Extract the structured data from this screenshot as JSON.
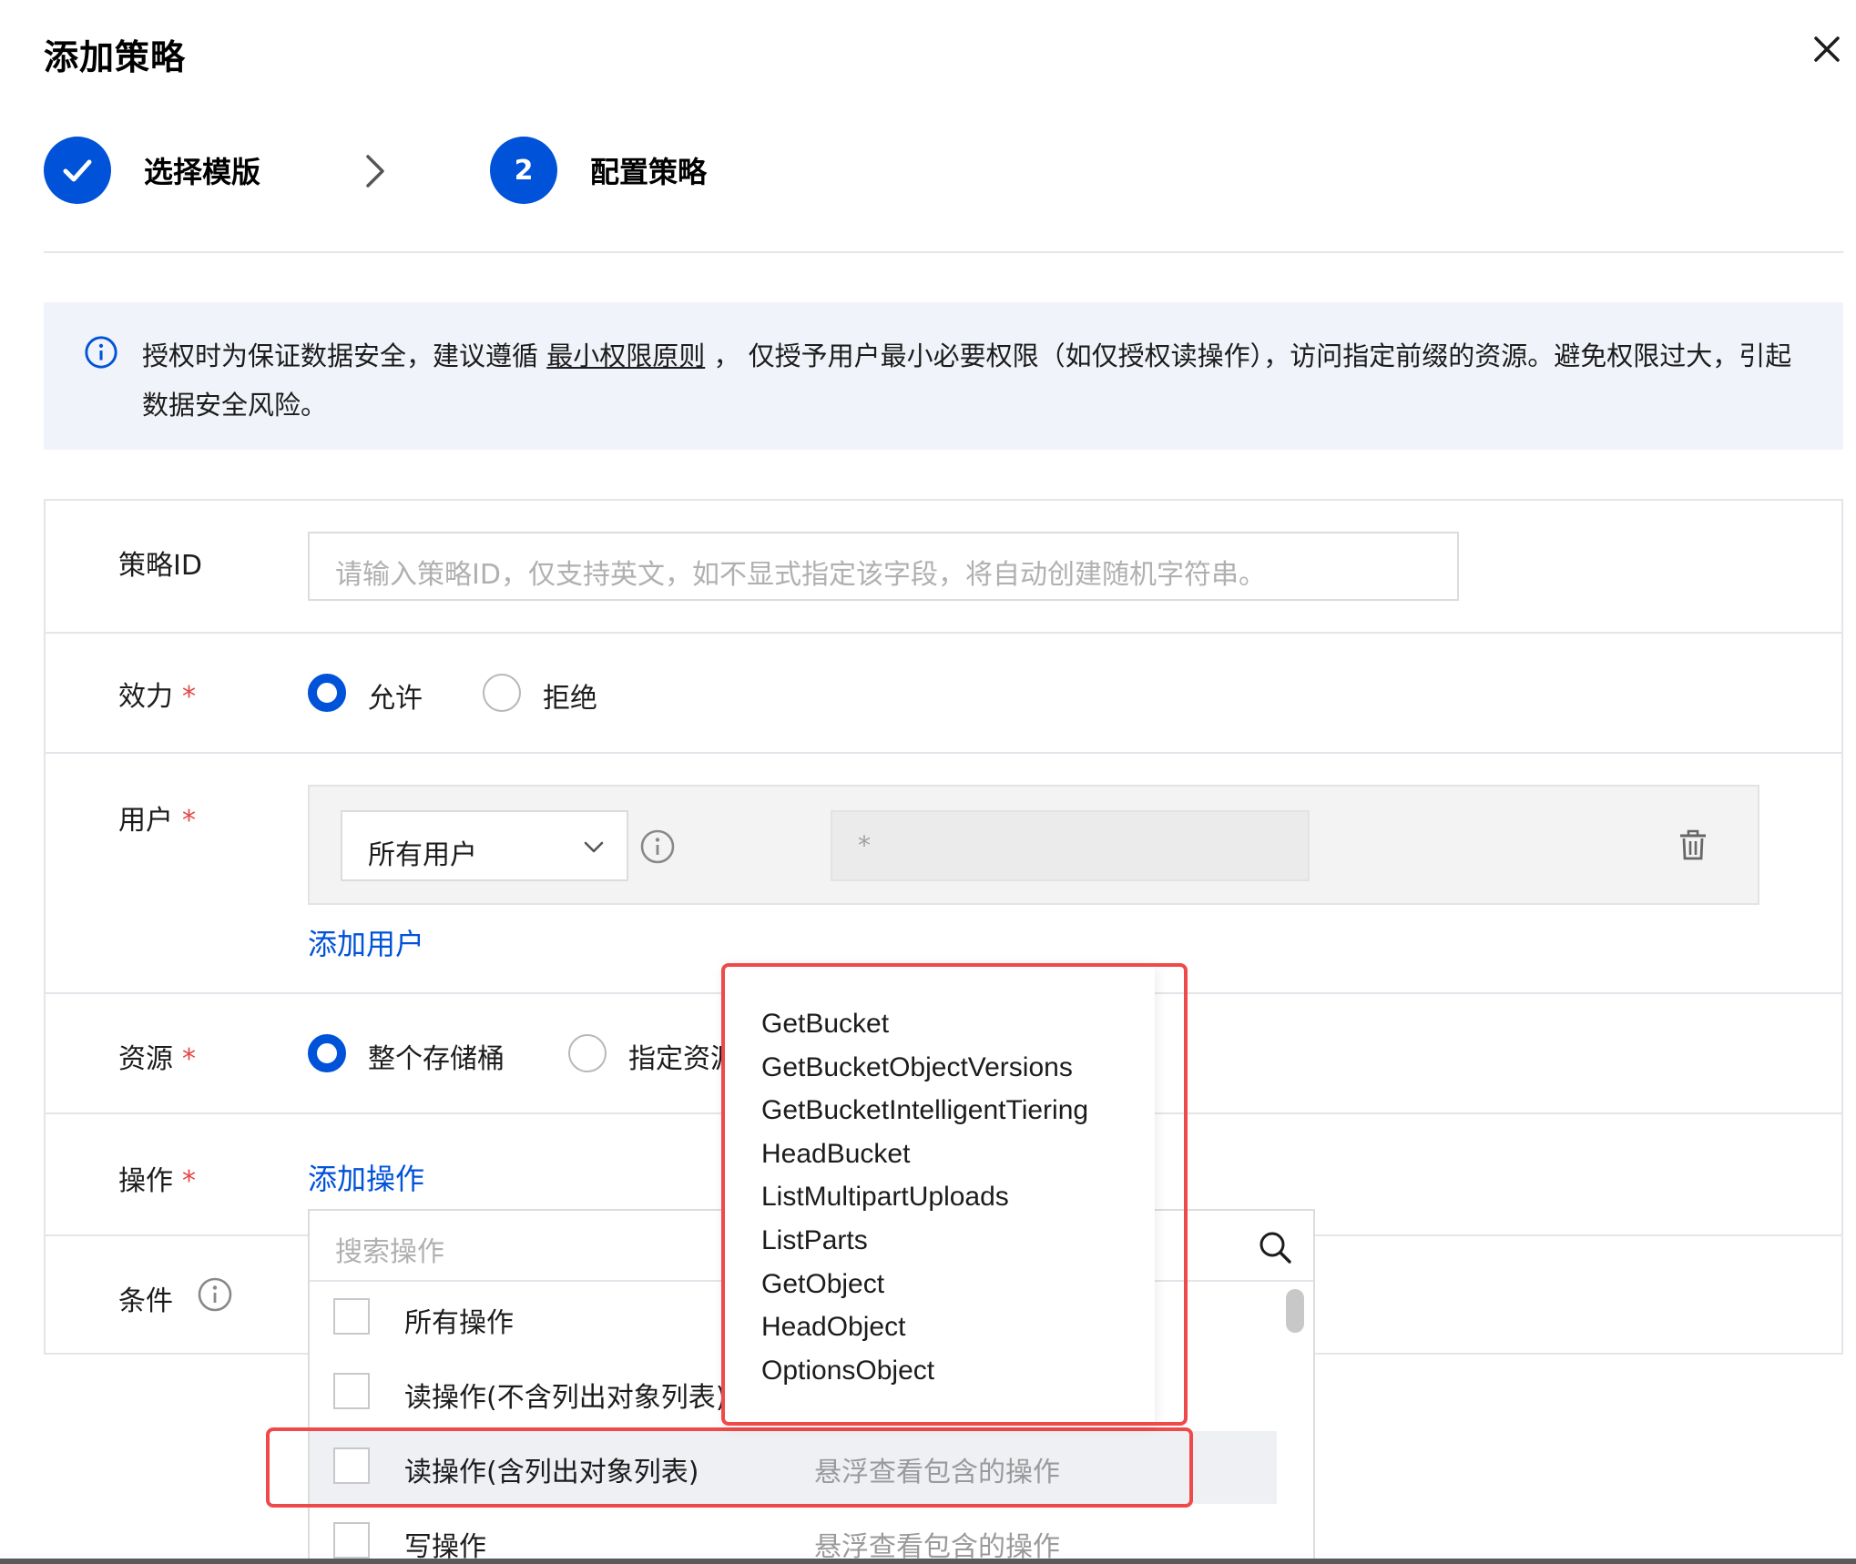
{
  "dialog": {
    "title": "添加策略"
  },
  "steps": [
    {
      "label": "选择模版",
      "state": "done"
    },
    {
      "number": "2",
      "label": "配置策略",
      "state": "active"
    }
  ],
  "notice": {
    "text_before": "授权时为保证数据安全，建议遵循 ",
    "link": "最小权限原则",
    "text_after": " ， 仅授予用户最小必要权限（如仅授权读操作），访问指定前缀的资源。避免权限过大，引起数据安全风险。"
  },
  "form": {
    "policy_id": {
      "label": "策略ID",
      "placeholder": "请输入策略ID，仅支持英文，如不显式指定该字段，将自动创建随机字符串。"
    },
    "effect": {
      "label": "效力",
      "required_mark": "*",
      "options": [
        "允许",
        "拒绝"
      ],
      "selected": "允许"
    },
    "user": {
      "label": "用户",
      "required_mark": "*",
      "select_value": "所有用户",
      "value_placeholder": "*",
      "add_link": "添加用户"
    },
    "resource": {
      "label": "资源",
      "required_mark": "*",
      "options": [
        "整个存储桶",
        "指定资源"
      ],
      "selected": "整个存储桶"
    },
    "action": {
      "label": "操作",
      "required_mark": "*",
      "add_link": "添加操作"
    },
    "condition": {
      "label": "条件"
    }
  },
  "action_dropdown": {
    "search_placeholder": "搜索操作",
    "options": [
      {
        "label": "所有操作",
        "hint": ""
      },
      {
        "label": "读操作(不含列出对象列表)",
        "hint": ""
      },
      {
        "label": "读操作(含列出对象列表)",
        "hint": "悬浮查看包含的操作"
      },
      {
        "label": "写操作",
        "hint": "悬浮查看包含的操作"
      }
    ]
  },
  "tooltip_actions": [
    "GetBucket",
    "GetBucketObjectVersions",
    "GetBucketIntelligentTiering",
    "HeadBucket",
    "ListMultipartUploads",
    "ListParts",
    "GetObject",
    "HeadObject",
    "OptionsObject"
  ],
  "colors": {
    "primary": "#0052d9",
    "required": "#e54545",
    "highlight": "#f0494a",
    "notice_bg": "#f0f3f9"
  }
}
